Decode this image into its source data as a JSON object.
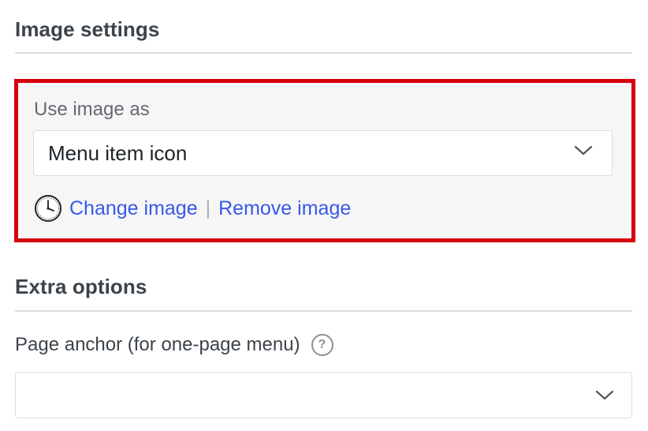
{
  "image_settings": {
    "title": "Image settings",
    "use_image_as_label": "Use image as",
    "use_image_as_value": "Menu item icon",
    "change_image_label": "Change image",
    "separator": "|",
    "remove_image_label": "Remove image",
    "highlight_color": "#d8000c",
    "link_color": "#3858e9"
  },
  "extra_options": {
    "title": "Extra options",
    "page_anchor_label": "Page anchor (for one-page menu)",
    "help_glyph": "?",
    "page_anchor_value": ""
  }
}
